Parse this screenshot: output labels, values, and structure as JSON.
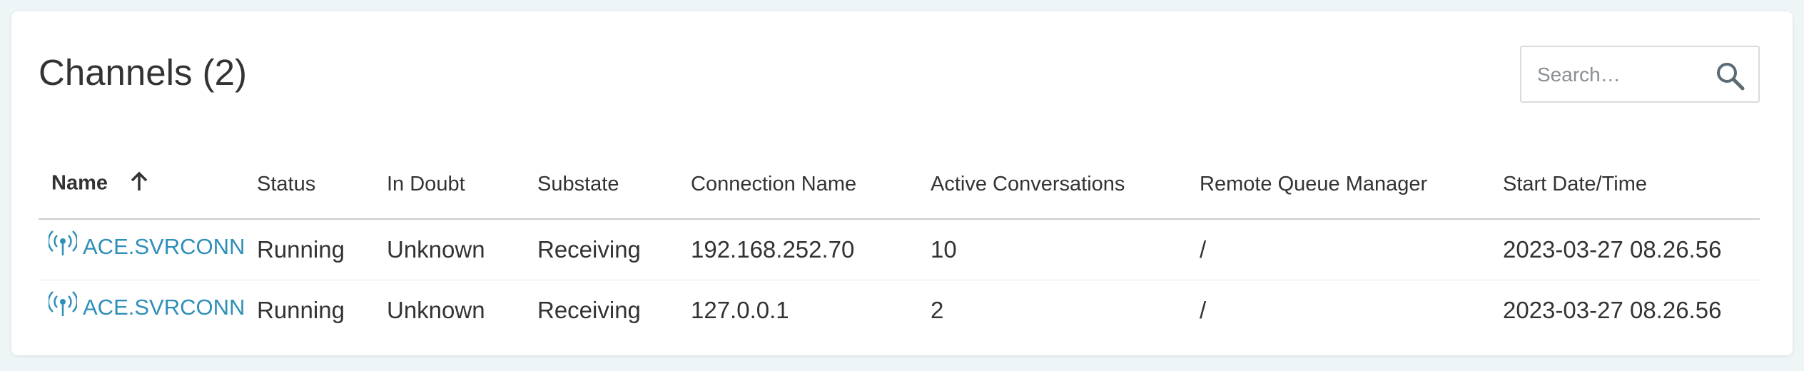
{
  "page": {
    "title": "Channels (2)"
  },
  "search": {
    "placeholder": "Search…",
    "icon": "search-icon"
  },
  "table": {
    "columns": [
      "Name",
      "Status",
      "In Doubt",
      "Substate",
      "Connection Name",
      "Active Conversations",
      "Remote Queue Manager",
      "Start Date/Time"
    ],
    "sort": {
      "column": "Name",
      "direction": "ascending",
      "icon": "arrow-up-icon"
    },
    "rows": [
      {
        "name": "ACE.SVRCONN",
        "status": "Running",
        "in_doubt": "Unknown",
        "substate": "Receiving",
        "connection_name": "192.168.252.70",
        "active_conversations": "10",
        "remote_queue_manager": "/",
        "start": "2023-03-27 08.26.56",
        "icon": "channel-antenna-icon"
      },
      {
        "name": "ACE.SVRCONN",
        "status": "Running",
        "in_doubt": "Unknown",
        "substate": "Receiving",
        "connection_name": "127.0.0.1",
        "active_conversations": "2",
        "remote_queue_manager": "/",
        "start": "2023-03-27 08.26.56",
        "icon": "channel-antenna-icon"
      }
    ]
  },
  "colors": {
    "link": "#2e8fb8",
    "background": "#eef5f6",
    "card": "#ffffff",
    "text": "#333333"
  }
}
